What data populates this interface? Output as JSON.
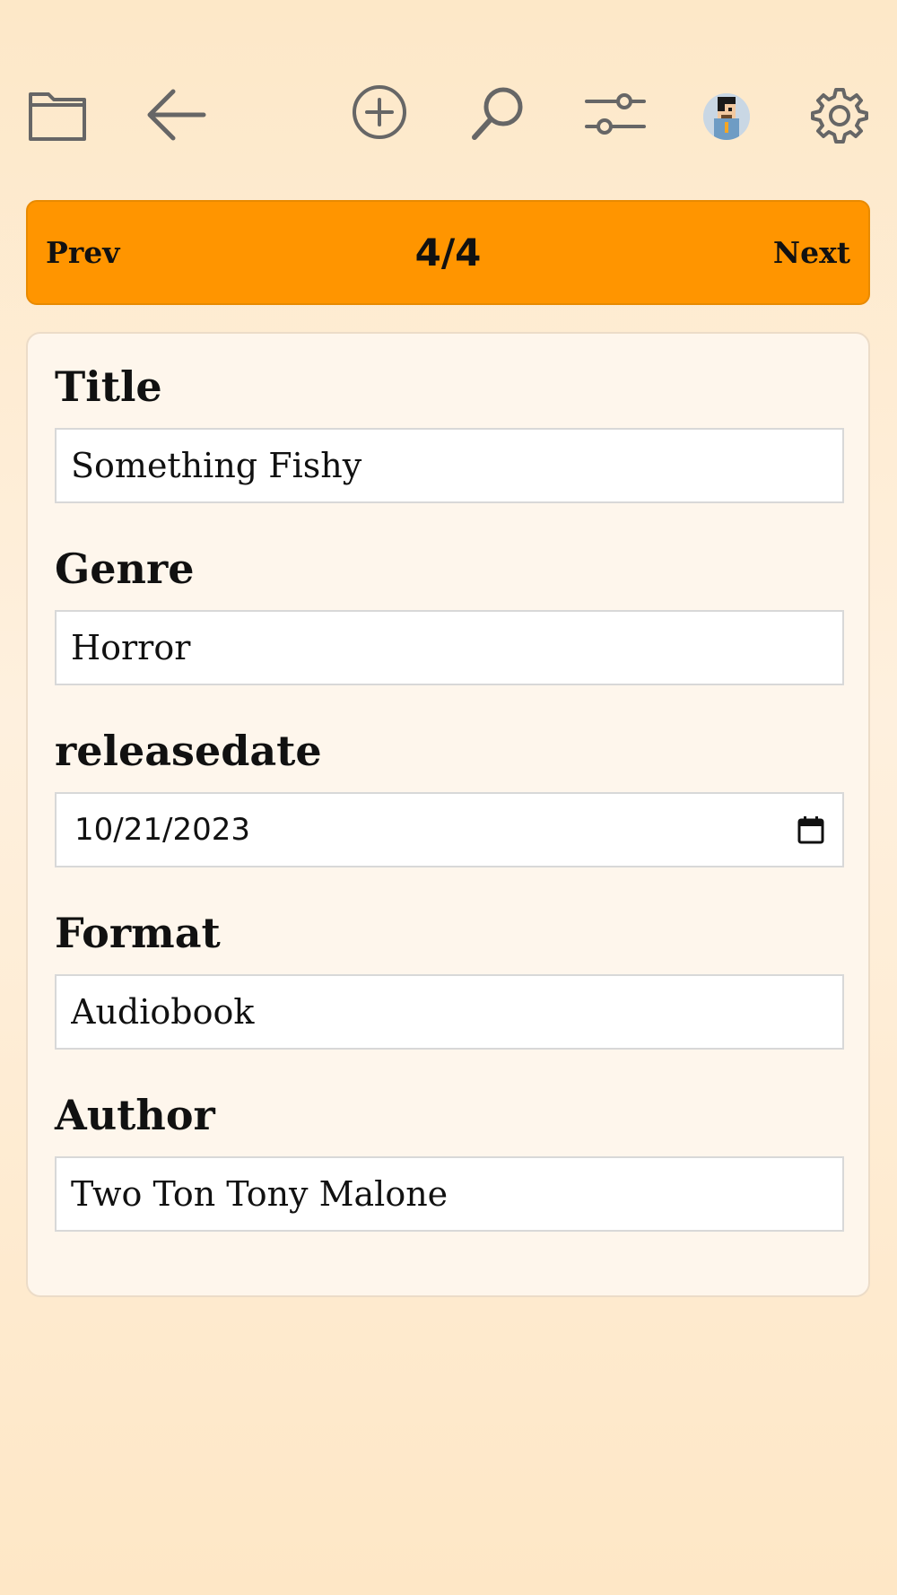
{
  "toolbar": {
    "icons": [
      "folder-icon",
      "back-arrow-icon",
      "add-circle-icon",
      "search-icon",
      "filter-sliders-icon",
      "avatar",
      "gear-icon"
    ],
    "icon_color": "#666666"
  },
  "pager": {
    "prev_label": "Prev",
    "counter": "4/4",
    "next_label": "Next",
    "accent_color": "#ff9500"
  },
  "form": {
    "fields": [
      {
        "label": "Title",
        "value": "Something Fishy"
      },
      {
        "label": "Genre",
        "value": "Horror"
      },
      {
        "label": "releasedate",
        "value": "10/21/2023",
        "type": "date"
      },
      {
        "label": "Format",
        "value": "Audiobook"
      },
      {
        "label": "Author",
        "value": "Two Ton Tony Malone"
      }
    ]
  }
}
